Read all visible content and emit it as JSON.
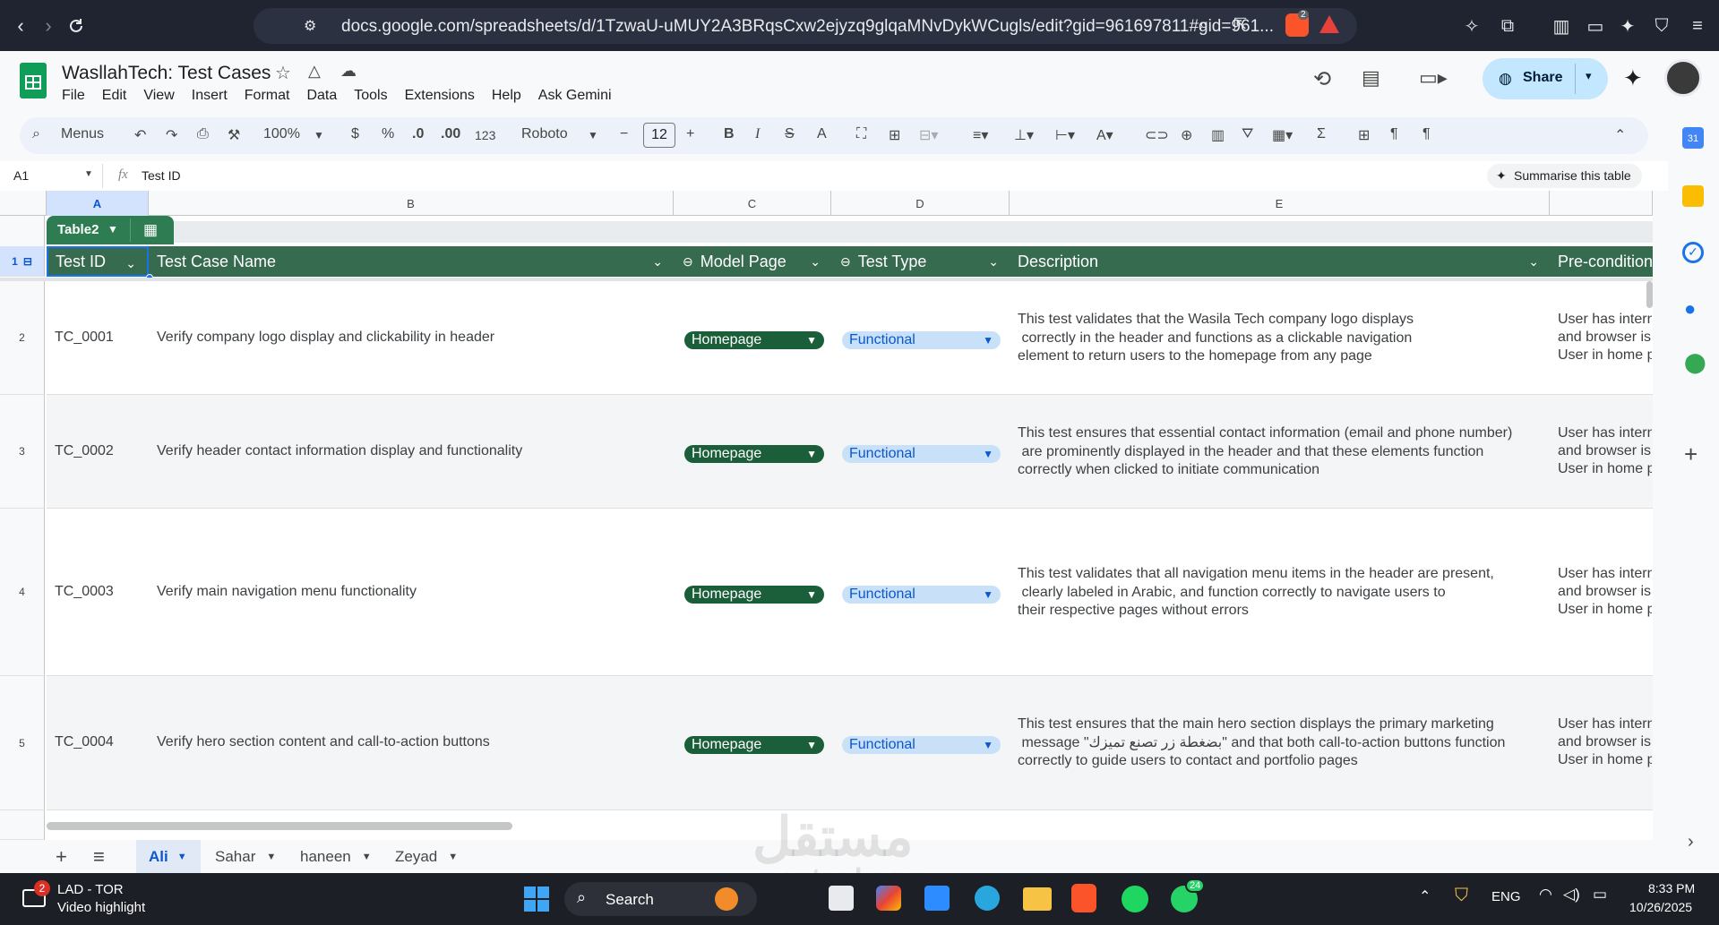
{
  "browser": {
    "url": "docs.google.com/spreadsheets/d/1TzwaU-uMUY2A3BRqsCxw2ejyzq9glqaMNvDykWCugls/edit?gid=961697811#gid=961...",
    "brave_badge": "2"
  },
  "doc": {
    "title": "WasllahTech: Test Cases",
    "menus": [
      "File",
      "Edit",
      "View",
      "Insert",
      "Format",
      "Data",
      "Tools",
      "Extensions",
      "Help",
      "Ask Gemini"
    ],
    "share_label": "Share"
  },
  "toolbar": {
    "menus_label": "Menus",
    "zoom": "100%",
    "currency": "$",
    "percent": "%",
    "dec_decrease": ".0",
    "dec_increase": ".00",
    "number_format": "123",
    "font": "Roboto",
    "font_size": "12",
    "bold": "B",
    "italic": "I",
    "strike": "S",
    "text_color": "A"
  },
  "formula_bar": {
    "cell_ref": "A1",
    "fx": "fx",
    "value": "Test ID",
    "summarise_label": "Summarise this table"
  },
  "grid": {
    "columns": [
      "A",
      "B",
      "C",
      "D",
      "E"
    ],
    "table_name": "Table2",
    "headers": [
      "Test ID",
      "Test Case Name",
      "Model Page",
      "Test Type",
      "Description",
      "Pre-condition"
    ],
    "header_row_num": "1",
    "rows": [
      {
        "num": "2",
        "id": "TC_0001",
        "name": "Verify company logo display and clickability in header",
        "page": "Homepage",
        "type": "Functional",
        "desc1": "This test validates that the Wasila Tech company logo displays",
        "desc2": " correctly in the header and functions as a clickable navigation",
        "desc3": "element to return users to the homepage from any page",
        "pre1": "User has intern",
        "pre2": "and browser is",
        "pre3": "User in home p"
      },
      {
        "num": "3",
        "id": "TC_0002",
        "name": "Verify header contact information display and functionality",
        "page": "Homepage",
        "type": "Functional",
        "desc1": "This test ensures that essential contact information (email and phone number)",
        "desc2": " are prominently displayed in the header and that these elements function",
        "desc3": "correctly when clicked to initiate communication",
        "pre1": "User has intern",
        "pre2": "and browser is",
        "pre3": "User in home p"
      },
      {
        "num": "4",
        "id": "TC_0003",
        "name": "Verify main navigation menu functionality",
        "page": "Homepage",
        "type": "Functional",
        "desc1": "This test validates that all navigation menu items in the header are present,",
        "desc2": " clearly labeled in Arabic, and function correctly to navigate users to",
        "desc3": "their respective pages without errors",
        "pre1": "User has intern",
        "pre2": "and browser is",
        "pre3": "User in home p"
      },
      {
        "num": "5",
        "id": "TC_0004",
        "name": "Verify hero section content and call-to-action buttons",
        "page": "Homepage",
        "type": "Functional",
        "desc1": "This test ensures that the main hero section displays the primary marketing",
        "desc2": " message \"بضغطة زر تصنع تميزك\" and that both call-to-action buttons function",
        "desc3": "correctly to guide users to contact and portfolio pages",
        "pre1": "User has intern",
        "pre2": "and browser is",
        "pre3": "User in home p"
      }
    ]
  },
  "sheets": {
    "add": "+",
    "list": "≡",
    "tabs": [
      "Ali",
      "Sahar",
      "haneen",
      "Zeyad"
    ],
    "active": "Ali"
  },
  "taskbar": {
    "notif_count": "2",
    "app_title": "LAD - TOR",
    "app_subtitle": "Video highlight",
    "search_label": "Search",
    "whatsapp_badge": "24",
    "lang": "ENG",
    "time": "8:33 PM",
    "date": "10/26/2025"
  },
  "watermark": {
    "text1": "مستقل",
    "text2": "mostaql.com"
  }
}
